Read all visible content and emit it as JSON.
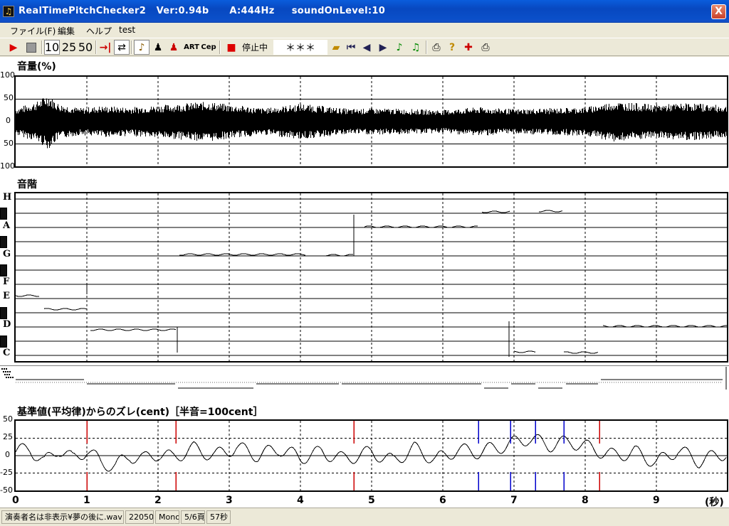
{
  "window": {
    "title": "RealTimePitchChecker2   Ver:0.94b      A:444Hz     soundOnLevel:10",
    "close_glyph": "X"
  },
  "menu": [
    "ファイル(F)",
    "編集",
    "ヘルプ",
    "test"
  ],
  "toolbar": {
    "zoom_10": "10",
    "zoom_25": "25",
    "zoom_50": "50",
    "art": "ART",
    "cep": "Cep",
    "status": "停止中",
    "note_display": "＊＊＊",
    "icons": [
      "play-icon",
      "stop-icon",
      "skip-to-end-icon",
      "loop-icon",
      "violin-icon",
      "player-icon",
      "singer-icon",
      "record-icon",
      "open-folder-icon",
      "first-icon",
      "prev-icon",
      "next-icon",
      "note-icon",
      "note2-icon",
      "print-icon",
      "help-icon",
      "mark-icon",
      "printer-icon"
    ]
  },
  "volume_panel": {
    "title": "音量(%)",
    "y_labels": [
      "100",
      "50",
      "0",
      "50",
      "100"
    ]
  },
  "scale_panel": {
    "title": "音階",
    "notes": [
      "H",
      "A",
      "G",
      "F",
      "E",
      "D",
      "C"
    ]
  },
  "deviation_panel": {
    "title": "基準値(平均律)からのズレ(cent)［半音=100cent］",
    "y_labels": [
      "50",
      "25",
      "0",
      "-25",
      "-50"
    ]
  },
  "x_axis": {
    "ticks": [
      "0",
      "1",
      "2",
      "3",
      "4",
      "5",
      "6",
      "7",
      "8",
      "9"
    ],
    "unit": "(秒)"
  },
  "statusbar": {
    "file": "演奏者名は非表示¥夢の後に.wav",
    "rate": "22050",
    "channels": "Mono",
    "page": "5/6頁",
    "duration": "57秒"
  },
  "chart_data": [
    {
      "type": "area",
      "title": "音量(%)",
      "ylim": [
        -100,
        100
      ],
      "xlim": [
        0,
        10
      ],
      "xlabel": "(秒)",
      "y_ticks": [
        100,
        50,
        0,
        -50,
        -100
      ],
      "x_ticks": [
        0,
        1,
        2,
        3,
        4,
        5,
        6,
        7,
        8,
        9
      ],
      "grid": true,
      "envelope": {
        "x": [
          0,
          0.3,
          0.45,
          0.6,
          0.9,
          1.2,
          1.6,
          2.3,
          2.7,
          3.0,
          3.5,
          4.0,
          4.7,
          5.0,
          5.5,
          6.0,
          6.5,
          7.0,
          7.5,
          8.0,
          8.4,
          9.0,
          9.5,
          10.0
        ],
        "amp": [
          30,
          45,
          62,
          40,
          30,
          35,
          32,
          40,
          45,
          38,
          30,
          40,
          28,
          30,
          28,
          26,
          32,
          28,
          30,
          32,
          45,
          38,
          42,
          35
        ]
      }
    },
    {
      "type": "line",
      "title": "音階",
      "y_categories": [
        "C",
        "D",
        "E",
        "F",
        "G",
        "A",
        "H"
      ],
      "xlim": [
        0,
        10
      ],
      "segments": [
        {
          "x": [
            0.0,
            0.35
          ],
          "note": "E",
          "offset": 0.2
        },
        {
          "x": [
            0.4,
            1.0
          ],
          "note": "E",
          "offset": -0.75
        },
        {
          "x": [
            1.05,
            2.25
          ],
          "note": "D",
          "offset": -0.2
        },
        {
          "x": [
            2.3,
            4.1
          ],
          "note": "G",
          "offset": 0.1
        },
        {
          "x": [
            4.35,
            4.75
          ],
          "note": "G",
          "offset": 0.05
        },
        {
          "x": [
            4.9,
            6.5
          ],
          "note": "A",
          "offset": 0.05
        },
        {
          "x": [
            6.55,
            6.95
          ],
          "note": "A",
          "offset": 1.1
        },
        {
          "x": [
            7.35,
            7.7
          ],
          "note": "A",
          "offset": 1.15
        },
        {
          "x": [
            7.0,
            7.3
          ],
          "note": "C",
          "offset": 0.25
        },
        {
          "x": [
            7.7,
            8.2
          ],
          "note": "C",
          "offset": 0.2
        },
        {
          "x": [
            8.25,
            10.0
          ],
          "note": "D",
          "offset": 0.05
        }
      ]
    },
    {
      "type": "line",
      "title": "基準値(平均律)からのズレ(cent)［半音=100cent］",
      "ylim": [
        -50,
        50
      ],
      "y_ticks": [
        50,
        25,
        0,
        -25,
        -50
      ],
      "xlim": [
        0,
        10
      ],
      "xlabel": "(秒)",
      "grid": true,
      "series": [
        {
          "values": [
            {
              "x": 0.0,
              "y": 5
            },
            {
              "x": 0.2,
              "y": 10
            },
            {
              "x": 0.4,
              "y": -10
            },
            {
              "x": 0.6,
              "y": 10
            },
            {
              "x": 0.8,
              "y": -5
            },
            {
              "x": 1.0,
              "y": 8
            },
            {
              "x": 1.2,
              "y": -10
            },
            {
              "x": 1.4,
              "y": -15
            },
            {
              "x": 1.6,
              "y": 0
            },
            {
              "x": 1.8,
              "y": -5
            },
            {
              "x": 2.0,
              "y": 3
            },
            {
              "x": 2.2,
              "y": -3
            },
            {
              "x": 2.5,
              "y": 10
            },
            {
              "x": 2.8,
              "y": 0
            },
            {
              "x": 3.1,
              "y": 12
            },
            {
              "x": 3.4,
              "y": 0
            },
            {
              "x": 3.7,
              "y": 10
            },
            {
              "x": 4.0,
              "y": -3
            },
            {
              "x": 4.3,
              "y": 5
            },
            {
              "x": 4.6,
              "y": -5
            },
            {
              "x": 5.0,
              "y": 5
            },
            {
              "x": 5.3,
              "y": -8
            },
            {
              "x": 5.6,
              "y": 10
            },
            {
              "x": 5.9,
              "y": -6
            },
            {
              "x": 6.2,
              "y": 8
            },
            {
              "x": 6.5,
              "y": 5
            },
            {
              "x": 6.9,
              "y": 15
            },
            {
              "x": 7.2,
              "y": 25
            },
            {
              "x": 7.5,
              "y": 15
            },
            {
              "x": 7.8,
              "y": 20
            },
            {
              "x": 8.1,
              "y": 10
            },
            {
              "x": 8.4,
              "y": 0
            },
            {
              "x": 8.7,
              "y": 5
            },
            {
              "x": 9.0,
              "y": -10
            },
            {
              "x": 9.3,
              "y": 8
            },
            {
              "x": 9.6,
              "y": -8
            },
            {
              "x": 10.0,
              "y": 5
            }
          ]
        }
      ],
      "markers": [
        {
          "x": 1.0,
          "color": "#cc0000"
        },
        {
          "x": 2.25,
          "color": "#cc0000"
        },
        {
          "x": 4.75,
          "color": "#cc0000"
        },
        {
          "x": 6.5,
          "color": "#0000cc"
        },
        {
          "x": 6.95,
          "color": "#0000cc"
        },
        {
          "x": 7.3,
          "color": "#0000cc"
        },
        {
          "x": 7.7,
          "color": "#0000cc"
        },
        {
          "x": 8.2,
          "color": "#cc0000"
        }
      ]
    }
  ]
}
